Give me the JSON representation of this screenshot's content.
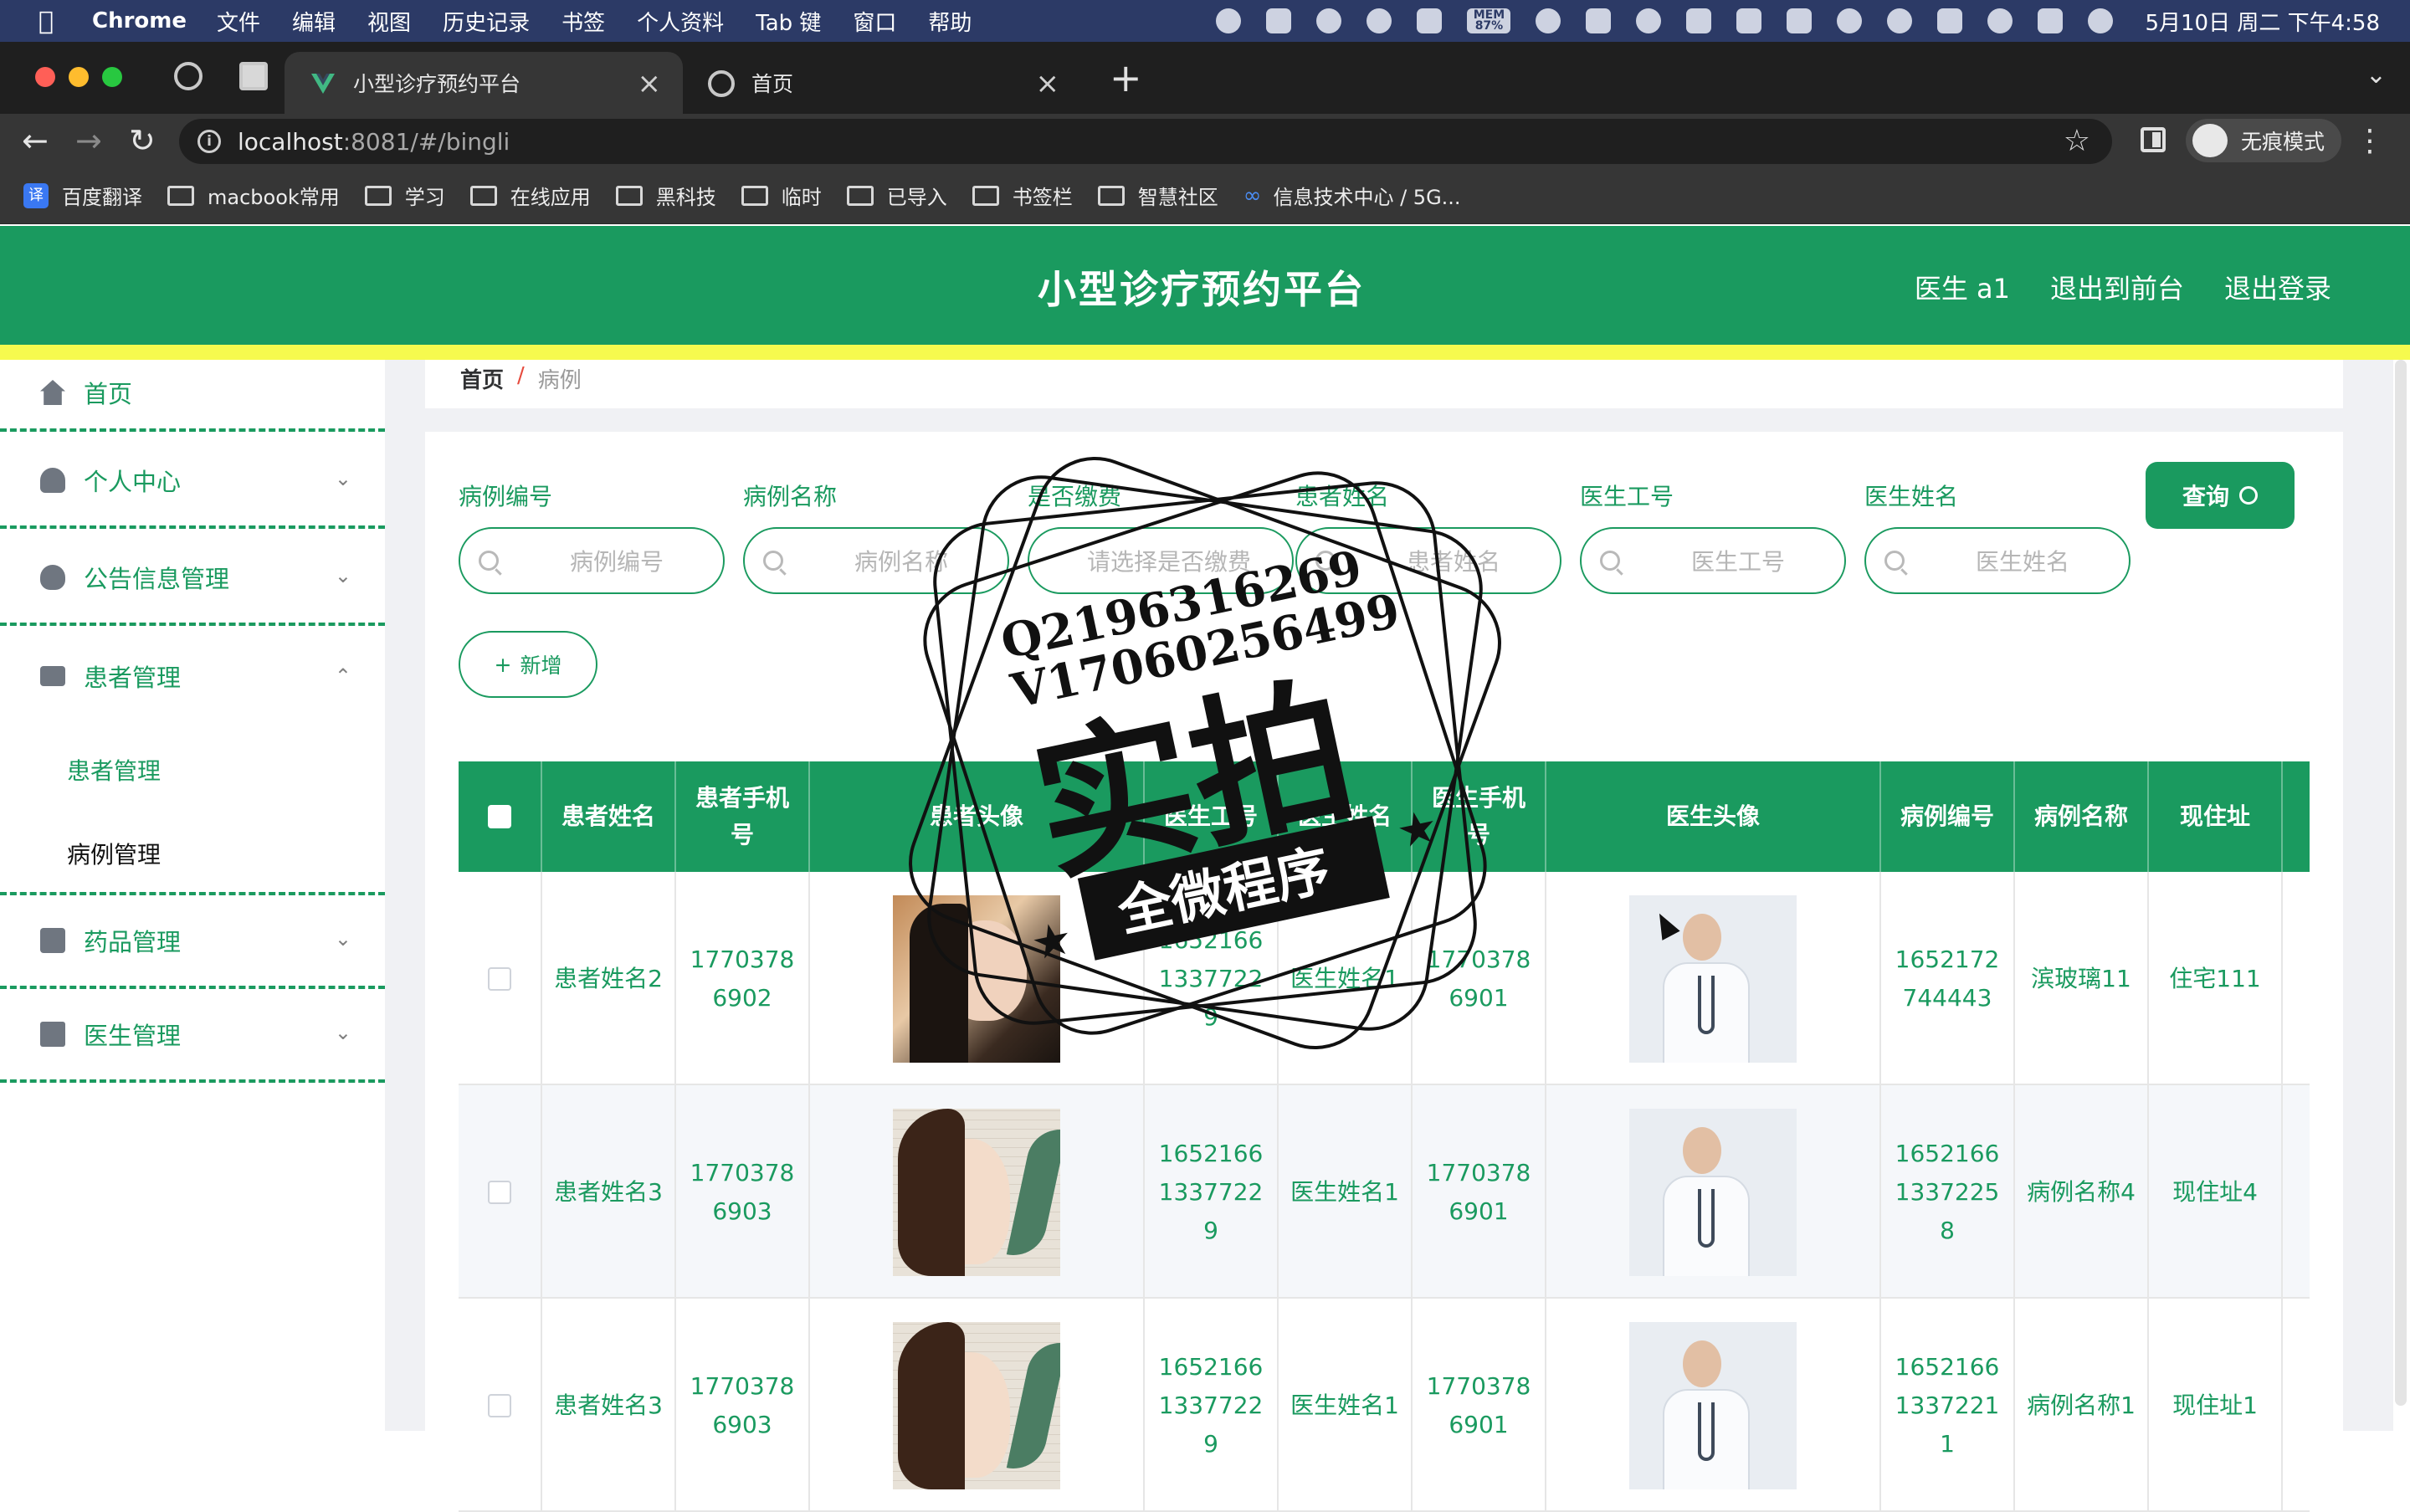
{
  "menubar": {
    "app": "Chrome",
    "items": [
      "文件",
      "编辑",
      "视图",
      "历史记录",
      "书签",
      "个人资料",
      "Tab 键",
      "窗口",
      "帮助"
    ],
    "mem_label": "MEM",
    "mem_value": "87%",
    "clock": "5月10日 周二 下午4:58"
  },
  "browser": {
    "tabs": [
      {
        "title": "小型诊疗预约平台"
      },
      {
        "title": "首页"
      }
    ],
    "url_host": "localhost",
    "url_path": ":8081/#/bingli",
    "profile": "无痕模式",
    "bookmarks": [
      "百度翻译",
      "macbook常用",
      "学习",
      "在线应用",
      "黑科技",
      "临时",
      "已导入",
      "书签栏",
      "智慧社区",
      "信息技术中心 / 5G..."
    ]
  },
  "header": {
    "title": "小型诊疗预约平台",
    "user": "医生 a1",
    "back_front": "退出到前台",
    "logout": "退出登录"
  },
  "sidebar": {
    "items": [
      {
        "label": "首页",
        "icon": "home-icon"
      },
      {
        "label": "个人中心",
        "icon": "user-icon"
      },
      {
        "label": "公告信息管理",
        "icon": "bulb-icon"
      },
      {
        "label": "患者管理",
        "icon": "bed-icon"
      },
      {
        "label": "药品管理",
        "icon": "medicine-box-icon"
      },
      {
        "label": "医生管理",
        "icon": "clipboard-icon"
      }
    ],
    "sub_items": [
      "患者管理",
      "病例管理"
    ]
  },
  "breadcrumb": {
    "home": "首页",
    "sep": "/",
    "current": "病例"
  },
  "filters": {
    "fields": [
      {
        "label": "病例编号",
        "placeholder": "病例编号"
      },
      {
        "label": "病例名称",
        "placeholder": "病例名称"
      },
      {
        "label": "是否缴费",
        "placeholder": "请选择是否缴费"
      },
      {
        "label": "患者姓名",
        "placeholder": "患者姓名"
      },
      {
        "label": "医生工号",
        "placeholder": "医生工号"
      },
      {
        "label": "医生姓名",
        "placeholder": "医生姓名"
      }
    ],
    "query_label": "查询",
    "add_label": "新增",
    "add_icon": "+"
  },
  "table": {
    "headers": [
      "患者姓名",
      "患者手机号",
      "患者头像",
      "医生工号",
      "医生姓名",
      "医生手机号",
      "医生头像",
      "病例编号",
      "病例名称",
      "现住址"
    ],
    "rows": [
      {
        "patient_name": "患者姓名2",
        "patient_phone": "17703786902",
        "doctor_no": "165216613377229",
        "doctor_name": "医生姓名1",
        "doctor_phone": "17703786901",
        "case_no": "1652172744443",
        "case_name": "滨玻璃11",
        "address": "住宅111"
      },
      {
        "patient_name": "患者姓名3",
        "patient_phone": "17703786903",
        "doctor_no": "165216613377229",
        "doctor_name": "医生姓名1",
        "doctor_phone": "17703786901",
        "case_no": "165216613372258",
        "case_name": "病例名称4",
        "address": "现住址4"
      },
      {
        "patient_name": "患者姓名3",
        "patient_phone": "17703786903",
        "doctor_no": "165216613377229",
        "doctor_name": "医生姓名1",
        "doctor_phone": "17703786901",
        "case_no": "165216613372211",
        "case_name": "病例名称1",
        "address": "现住址1"
      }
    ]
  },
  "watermark": {
    "line1": "Q2196316269",
    "line2": "V17060256499",
    "big": "实拍",
    "ribbon": "全微程序"
  },
  "colors": {
    "brand": "#1a9a5f",
    "accent_yellow": "#f6fa4e",
    "crumb_sep": "#e64a3d"
  }
}
